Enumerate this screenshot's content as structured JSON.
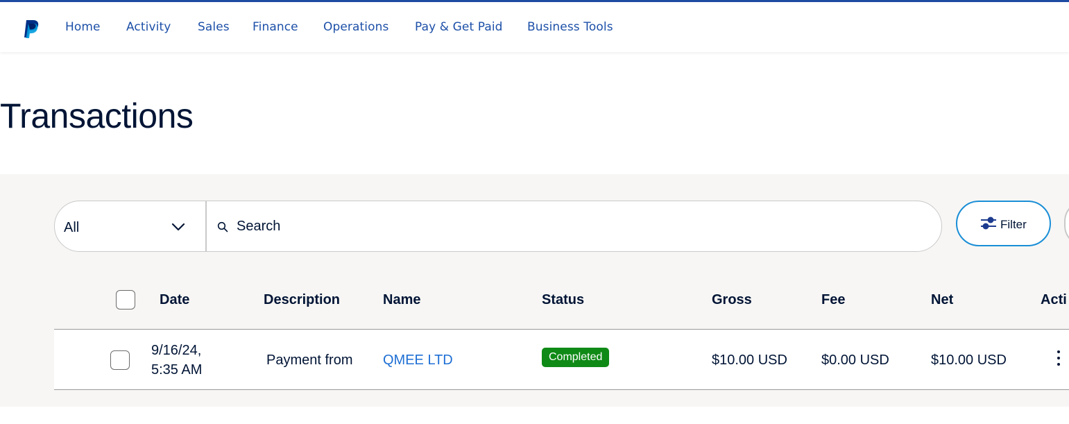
{
  "colors": {
    "brand": "#1d4ba3",
    "nav_link": "#1d50a8",
    "title": "#001435",
    "status_completed": "#0f8a16",
    "link": "#1e6fd4",
    "filter_border": "#1a8ed6"
  },
  "nav": {
    "logo_icon": "paypal-logo",
    "items": [
      "Home",
      "Activity",
      "Sales",
      "Finance",
      "Operations",
      "Pay & Get Paid",
      "Business Tools"
    ]
  },
  "page": {
    "title": "Transactions"
  },
  "toolbar": {
    "type_select": {
      "value": "All",
      "icon": "chevron-down-icon"
    },
    "search": {
      "placeholder": "Search",
      "value": "",
      "icon": "search-icon"
    },
    "filter": {
      "label": "Filter",
      "icon": "sliders-icon"
    }
  },
  "table": {
    "columns": [
      "Date",
      "Description",
      "Name",
      "Status",
      "Gross",
      "Fee",
      "Net",
      "Acti"
    ],
    "rows": [
      {
        "date": "9/16/24,",
        "time": "5:35 AM",
        "description": "Payment from",
        "name": "QMEE LTD",
        "status": "Completed",
        "gross": "$10.00 USD",
        "fee": "$0.00 USD",
        "net": "$10.00 USD",
        "actions_icon": "more-vertical-icon"
      }
    ]
  }
}
